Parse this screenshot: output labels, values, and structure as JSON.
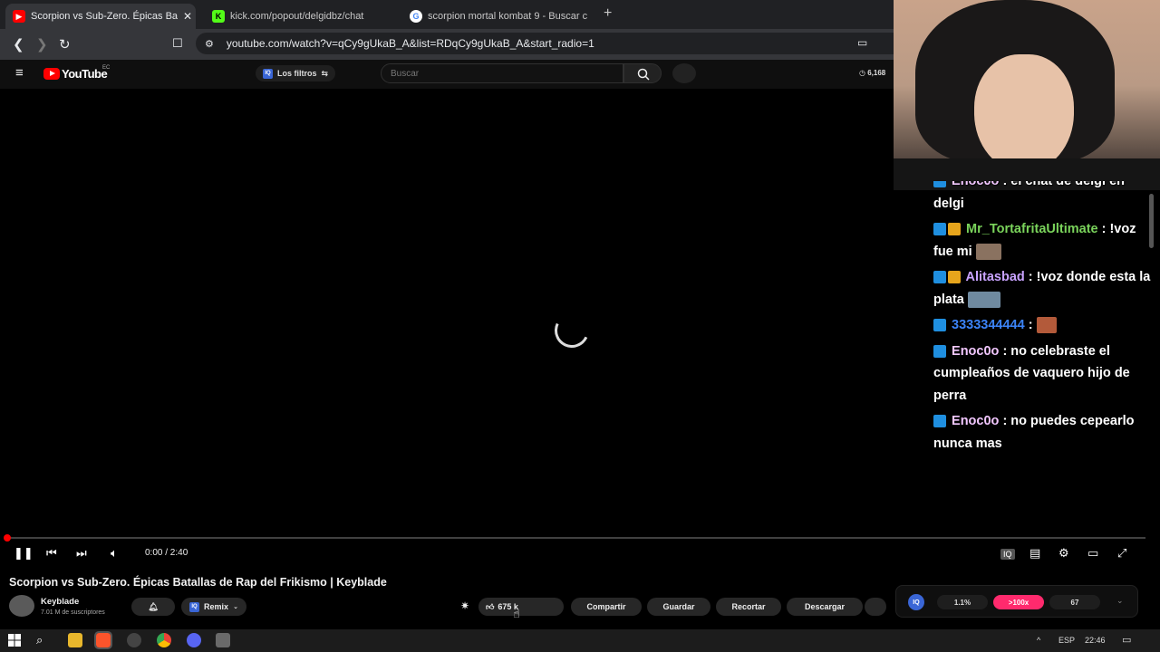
{
  "tabs": [
    {
      "title": "Scorpion vs Sub-Zero. Épicas Ba",
      "icon": "youtube-icon",
      "active": true
    },
    {
      "title": "kick.com/popout/delgidbz/chat",
      "icon": "kick-icon"
    },
    {
      "title": "scorpion mortal kombat 9 - Buscar c",
      "icon": "google-icon"
    }
  ],
  "address": {
    "url": "youtube.com/watch?v=qCy9gUkaB_A&list=RDqCy9gUkaB_A&start_radio=1"
  },
  "youtube_header": {
    "logo": "YouTube",
    "country": "EC",
    "filters_label": "Los filtros",
    "search_placeholder": "Buscar",
    "views_badge": "6,168"
  },
  "player": {
    "time": "0:00 / 2:40"
  },
  "video": {
    "title": "Scorpion vs Sub-Zero. Épicas Batallas de Rap del Frikismo | Keyblade",
    "channel": "Keyblade",
    "subscribers": "7.01 M de suscriptores",
    "remix_label": "Remix",
    "likes": "675 k",
    "share_label": "Compartir",
    "save_label": "Guardar",
    "clip_label": "Recortar",
    "download_label": "Descargar"
  },
  "extension": {
    "left": "1.1%",
    "middle": ">100x",
    "right": "67"
  },
  "chat": {
    "messages": [
      {
        "user": "Enoc0o",
        "text": ": el chat de delgi en delgi",
        "color": "#f2c7ff"
      },
      {
        "user": "Mr_TortafritaUltimate",
        "text": ": !voz fue mi",
        "color": "#7ad35b"
      },
      {
        "user": "Alitasbad",
        "text": ": !voz donde esta la plata",
        "color": "#c9a3ff"
      },
      {
        "user": "3333344444",
        "text": ":",
        "color": "#3b83f7"
      },
      {
        "user": "Enoc0o",
        "text": ": no celebraste el cumpleaños de vaquero hijo de perra",
        "color": "#f2c7ff"
      },
      {
        "user": "Enoc0o",
        "text": ": no puedes cepearlo nunca mas",
        "color": "#f2c7ff"
      }
    ]
  },
  "taskbar": {
    "language": "ESP",
    "time": "22:46"
  }
}
